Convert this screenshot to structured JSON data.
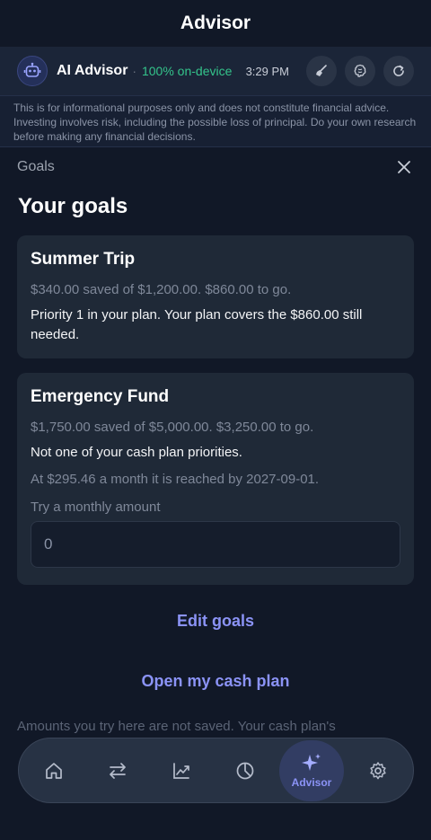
{
  "header": {
    "title": "Advisor"
  },
  "advisor": {
    "name": "AI Advisor",
    "separator": "·",
    "status": "100% on-device",
    "time": "3:29 PM",
    "status_color": "#34c48b",
    "icons": [
      "sweep-icon",
      "brain-icon",
      "refresh-icon"
    ]
  },
  "disclaimer": "This is for informational purposes only and does not constitute financial advice. Investing involves risk, including the possible loss of principal. Do your own research before making any financial decisions.",
  "panel": {
    "label": "Goals",
    "heading": "Your goals"
  },
  "goals": [
    {
      "name": "Summer Trip",
      "progress": "$340.00 saved of $1,200.00. $860.00 to go.",
      "note": "Priority 1 in your plan. Your plan covers the $860.00 still needed."
    },
    {
      "name": "Emergency Fund",
      "progress": "$1,750.00 saved of $5,000.00. $3,250.00 to go.",
      "note": "Not one of your cash plan priorities.",
      "projection": "At $295.46 a month it is reached by 2027-09-01.",
      "try_label": "Try a monthly amount",
      "try_placeholder": "0"
    }
  ],
  "actions": {
    "edit_goals": "Edit goals",
    "open_plan": "Open my cash plan"
  },
  "footnote": "Amounts you try here are not saved. Your cash plan's",
  "tabs": [
    {
      "icon": "home-icon",
      "label": ""
    },
    {
      "icon": "transfer-icon",
      "label": ""
    },
    {
      "icon": "trend-chart-icon",
      "label": ""
    },
    {
      "icon": "pie-chart-icon",
      "label": ""
    },
    {
      "icon": "sparkle-icon",
      "label": "Advisor",
      "active": true
    },
    {
      "icon": "gear-icon",
      "label": ""
    }
  ],
  "accent": "#8b93f6"
}
